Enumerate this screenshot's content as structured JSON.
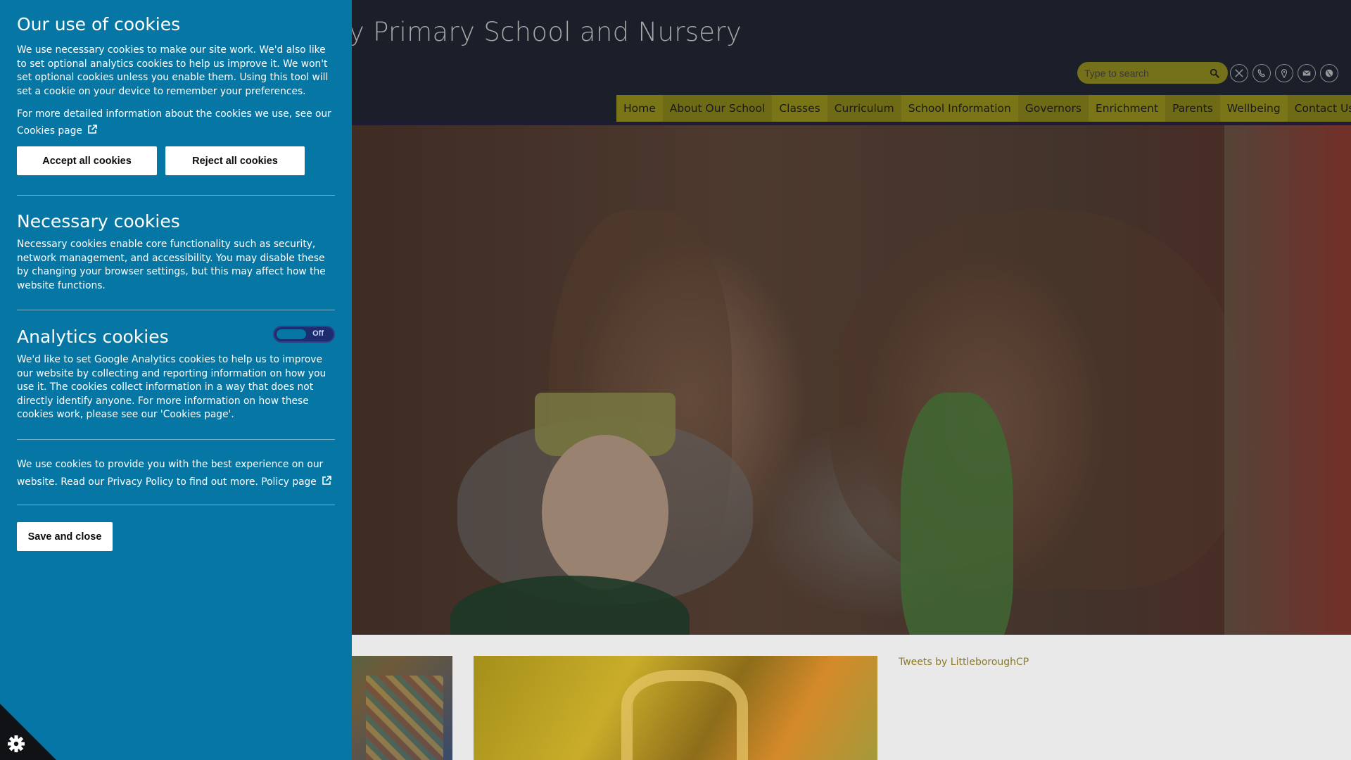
{
  "site": {
    "title": "Littleborough Community Primary School and Nursery",
    "search_placeholder": "Type to search",
    "social_icons": [
      "x-icon",
      "phone-icon",
      "map-pin-icon",
      "email-icon",
      "globe-icon"
    ],
    "nav": [
      "Home",
      "About Our School",
      "Classes",
      "Curriculum",
      "School Information",
      "Governors",
      "Enrichment",
      "Parents",
      "Wellbeing",
      "Contact Us"
    ],
    "tweets_link": "Tweets by LittleboroughCP"
  },
  "cookie_panel": {
    "heading": "Our use of cookies",
    "intro": "We use necessary cookies to make our site work. We'd also like to set optional analytics cookies to help us improve it. We won't set optional cookies unless you enable them. Using this tool will set a cookie on your device to remember your preferences.",
    "more_info": "For more detailed information about the cookies we use, see our",
    "cookies_link": "Cookies page",
    "accept_label": "Accept all cookies",
    "reject_label": "Reject all cookies",
    "necessary_heading": "Necessary cookies",
    "necessary_text": "Necessary cookies enable core functionality such as security, network management, and accessibility. You may disable these by changing your browser settings, but this may affect how the website functions.",
    "analytics_heading": "Analytics cookies",
    "analytics_toggle_label": "Off",
    "analytics_enabled": false,
    "analytics_text": "We'd like to set Google Analytics cookies to help us to improve our website by collecting and reporting information on how you use it. The cookies collect information in a way that does not directly identify anyone. For more information on how these cookies work, please see our 'Cookies page'.",
    "privacy_text": "We use cookies to provide you with the best experience on our website. Read our Privacy Policy to find out more.",
    "policy_link": "Policy page",
    "save_label": "Save and close",
    "colors": {
      "panel_bg": "#0677a5",
      "toggle_bg": "#1d2c6e",
      "nav_bg": "#7a7517"
    }
  }
}
